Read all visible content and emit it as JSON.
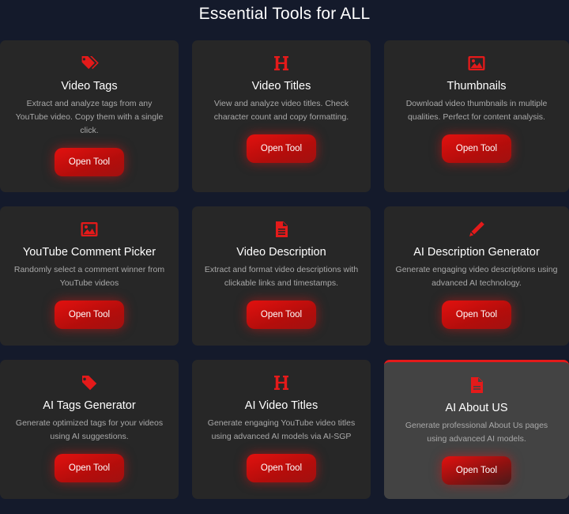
{
  "page": {
    "heading": "Essential Tools for ALL",
    "accent_color": "#e41a1a",
    "background_color": "#141a2b",
    "card_color": "#272727"
  },
  "tools": [
    {
      "icon": "tags-icon",
      "title": "Video Tags",
      "description": "Extract and analyze tags from any YouTube video. Copy them with a single click.",
      "button": "Open Tool"
    },
    {
      "icon": "heading-icon",
      "title": "Video Titles",
      "description": "View and analyze video titles. Check character count and copy formatting.",
      "button": "Open Tool"
    },
    {
      "icon": "image-icon",
      "title": "Thumbnails",
      "description": "Download video thumbnails in multiple qualities. Perfect for content analysis.",
      "button": "Open Tool"
    },
    {
      "icon": "image-icon",
      "title": "YouTube Comment Picker",
      "description": "Randomly select a comment winner from YouTube videos",
      "button": "Open Tool"
    },
    {
      "icon": "file-text-icon",
      "title": "Video Description",
      "description": "Extract and format video descriptions with clickable links and timestamps.",
      "button": "Open Tool"
    },
    {
      "icon": "pen-icon",
      "title": "AI Description Generator",
      "description": "Generate engaging video descriptions using advanced AI technology.",
      "button": "Open Tool"
    },
    {
      "icon": "tag-icon",
      "title": "AI Tags Generator",
      "description": "Generate optimized tags for your videos using AI suggestions.",
      "button": "Open Tool"
    },
    {
      "icon": "heading-icon",
      "title": "AI Video Titles",
      "description": "Generate engaging YouTube video titles using advanced AI models via AI-SGP",
      "button": "Open Tool"
    },
    {
      "icon": "file-icon",
      "title": "AI About US",
      "description": "Generate professional About Us pages using advanced AI models.",
      "button": "Open Tool",
      "hovered": true
    }
  ]
}
